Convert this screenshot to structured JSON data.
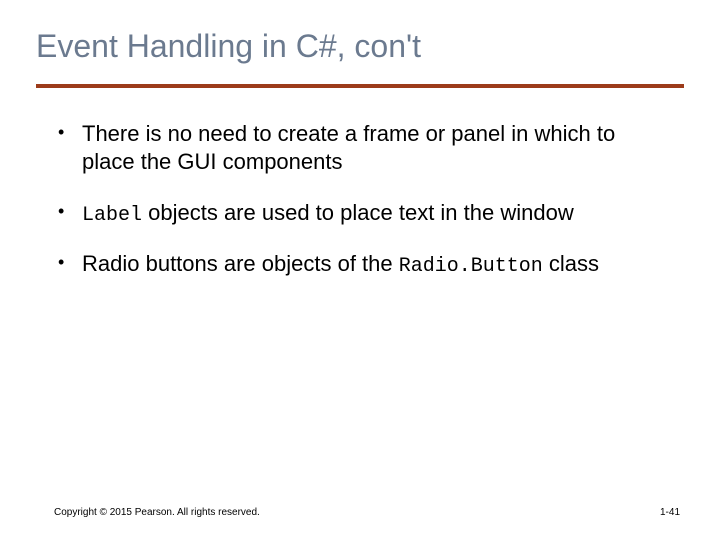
{
  "title": "Event Handling in C#, con't",
  "bullets": [
    {
      "pre": "There is no need to create a frame or panel in which to place the GUI components",
      "code": "",
      "post": ""
    },
    {
      "pre": "",
      "code": "Label",
      "post": " objects are used to place text in the window"
    },
    {
      "pre": "Radio buttons are objects of the ",
      "code": "Radio.Button",
      "post": " class"
    }
  ],
  "footer": {
    "copyright": "Copyright © 2015 Pearson. All rights reserved.",
    "page": "1-41"
  }
}
